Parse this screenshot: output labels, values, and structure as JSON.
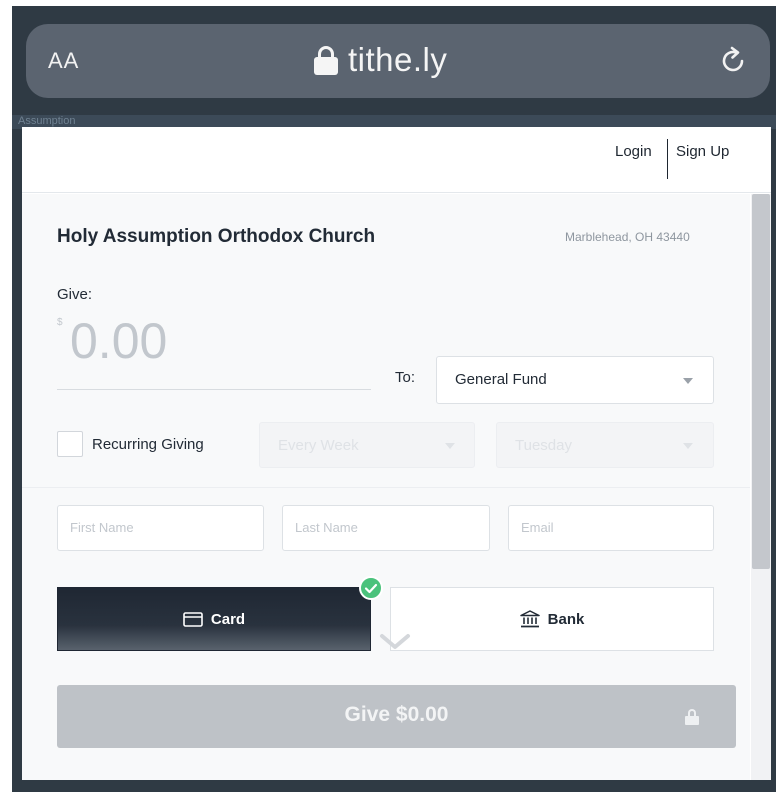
{
  "browser": {
    "text_size_label": "AA",
    "url": "tithe.ly"
  },
  "background_strip_text": "Assumption",
  "header": {
    "login": "Login",
    "signup": "Sign Up"
  },
  "church": {
    "name": "Holy Assumption Orthodox Church",
    "location": "Marblehead, OH 43440"
  },
  "give": {
    "label": "Give:",
    "currency_symbol": "$",
    "amount": "0.00"
  },
  "fund": {
    "to_label": "To:",
    "selected": "General Fund"
  },
  "recurring": {
    "label": "Recurring Giving",
    "checked": false,
    "frequency": "Every Week",
    "day": "Tuesday"
  },
  "fields": {
    "first_name_placeholder": "First Name",
    "last_name_placeholder": "Last Name",
    "email_placeholder": "Email"
  },
  "payment": {
    "card_label": "Card",
    "bank_label": "Bank",
    "selected": "Card"
  },
  "submit": {
    "label": "Give $0.00"
  },
  "colors": {
    "card_tab_bg": "#1f2733",
    "check_green": "#4bc27c",
    "disabled_button": "#bec2c7",
    "address_bar": "#5b6470"
  },
  "icons": {
    "address_lock": "lock-icon",
    "reload": "reload-icon",
    "card": "credit-card-icon",
    "bank": "bank-icon",
    "selected_check": "check-icon",
    "scroll_hint": "chevron-down-icon",
    "submit_lock": "lock-icon"
  }
}
